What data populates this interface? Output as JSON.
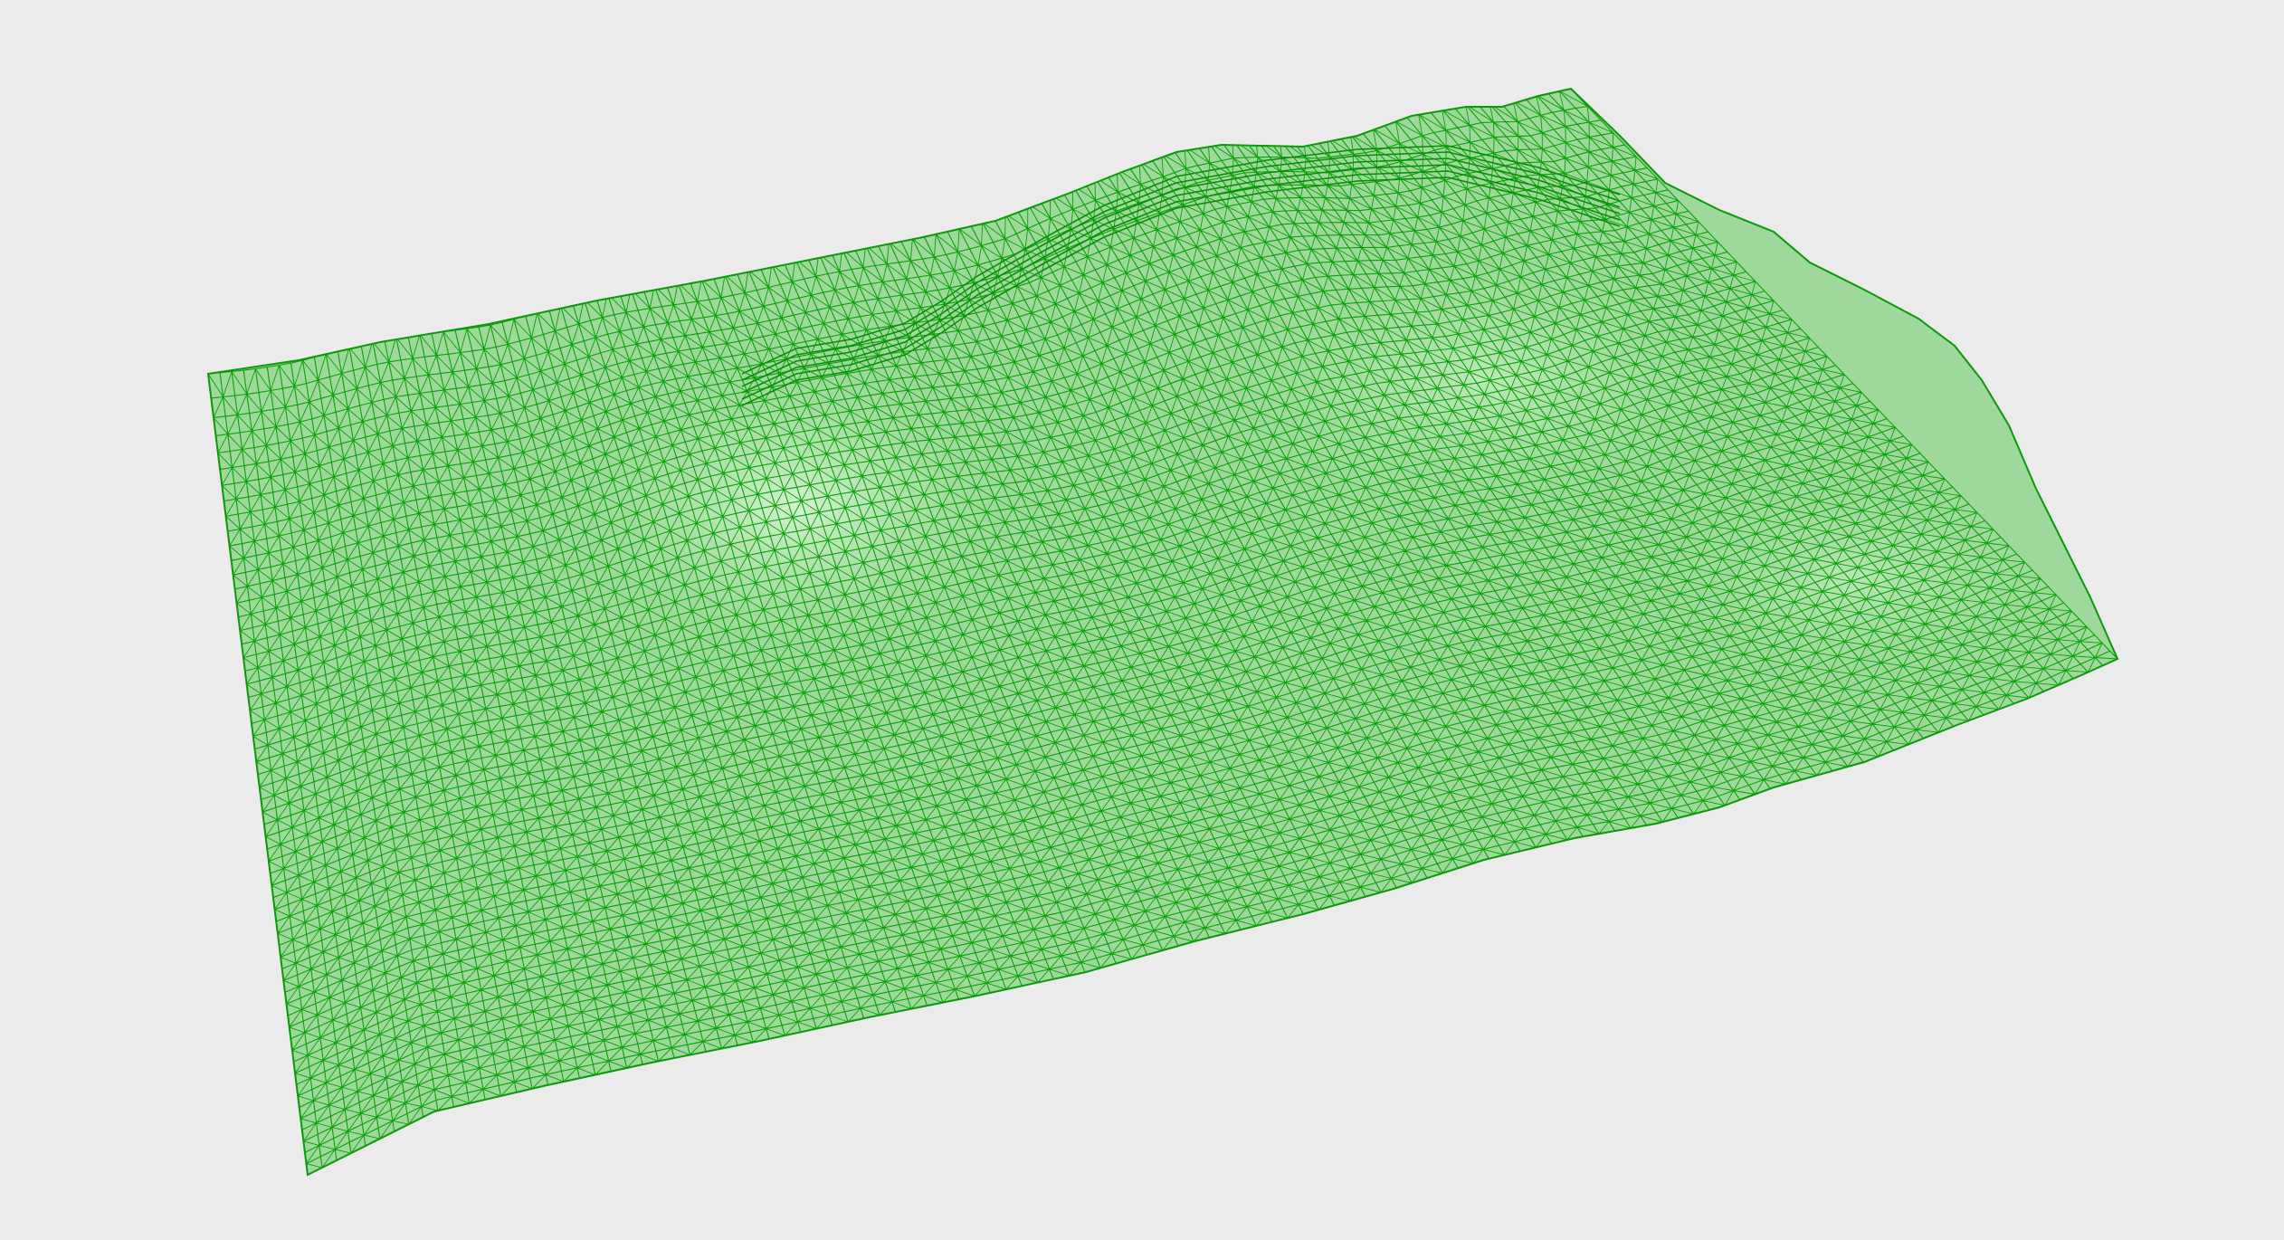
{
  "viewport": {
    "background_color": "#ebebeb",
    "object": "terrain-mesh"
  },
  "mesh": {
    "type": "triangulated-terrain-wireframe",
    "fill_color": "#9ed89a",
    "wire_color": "#0aa00a",
    "highlight_color": "#c9f0c4",
    "display_mode": "shaded-with-wireframe"
  }
}
